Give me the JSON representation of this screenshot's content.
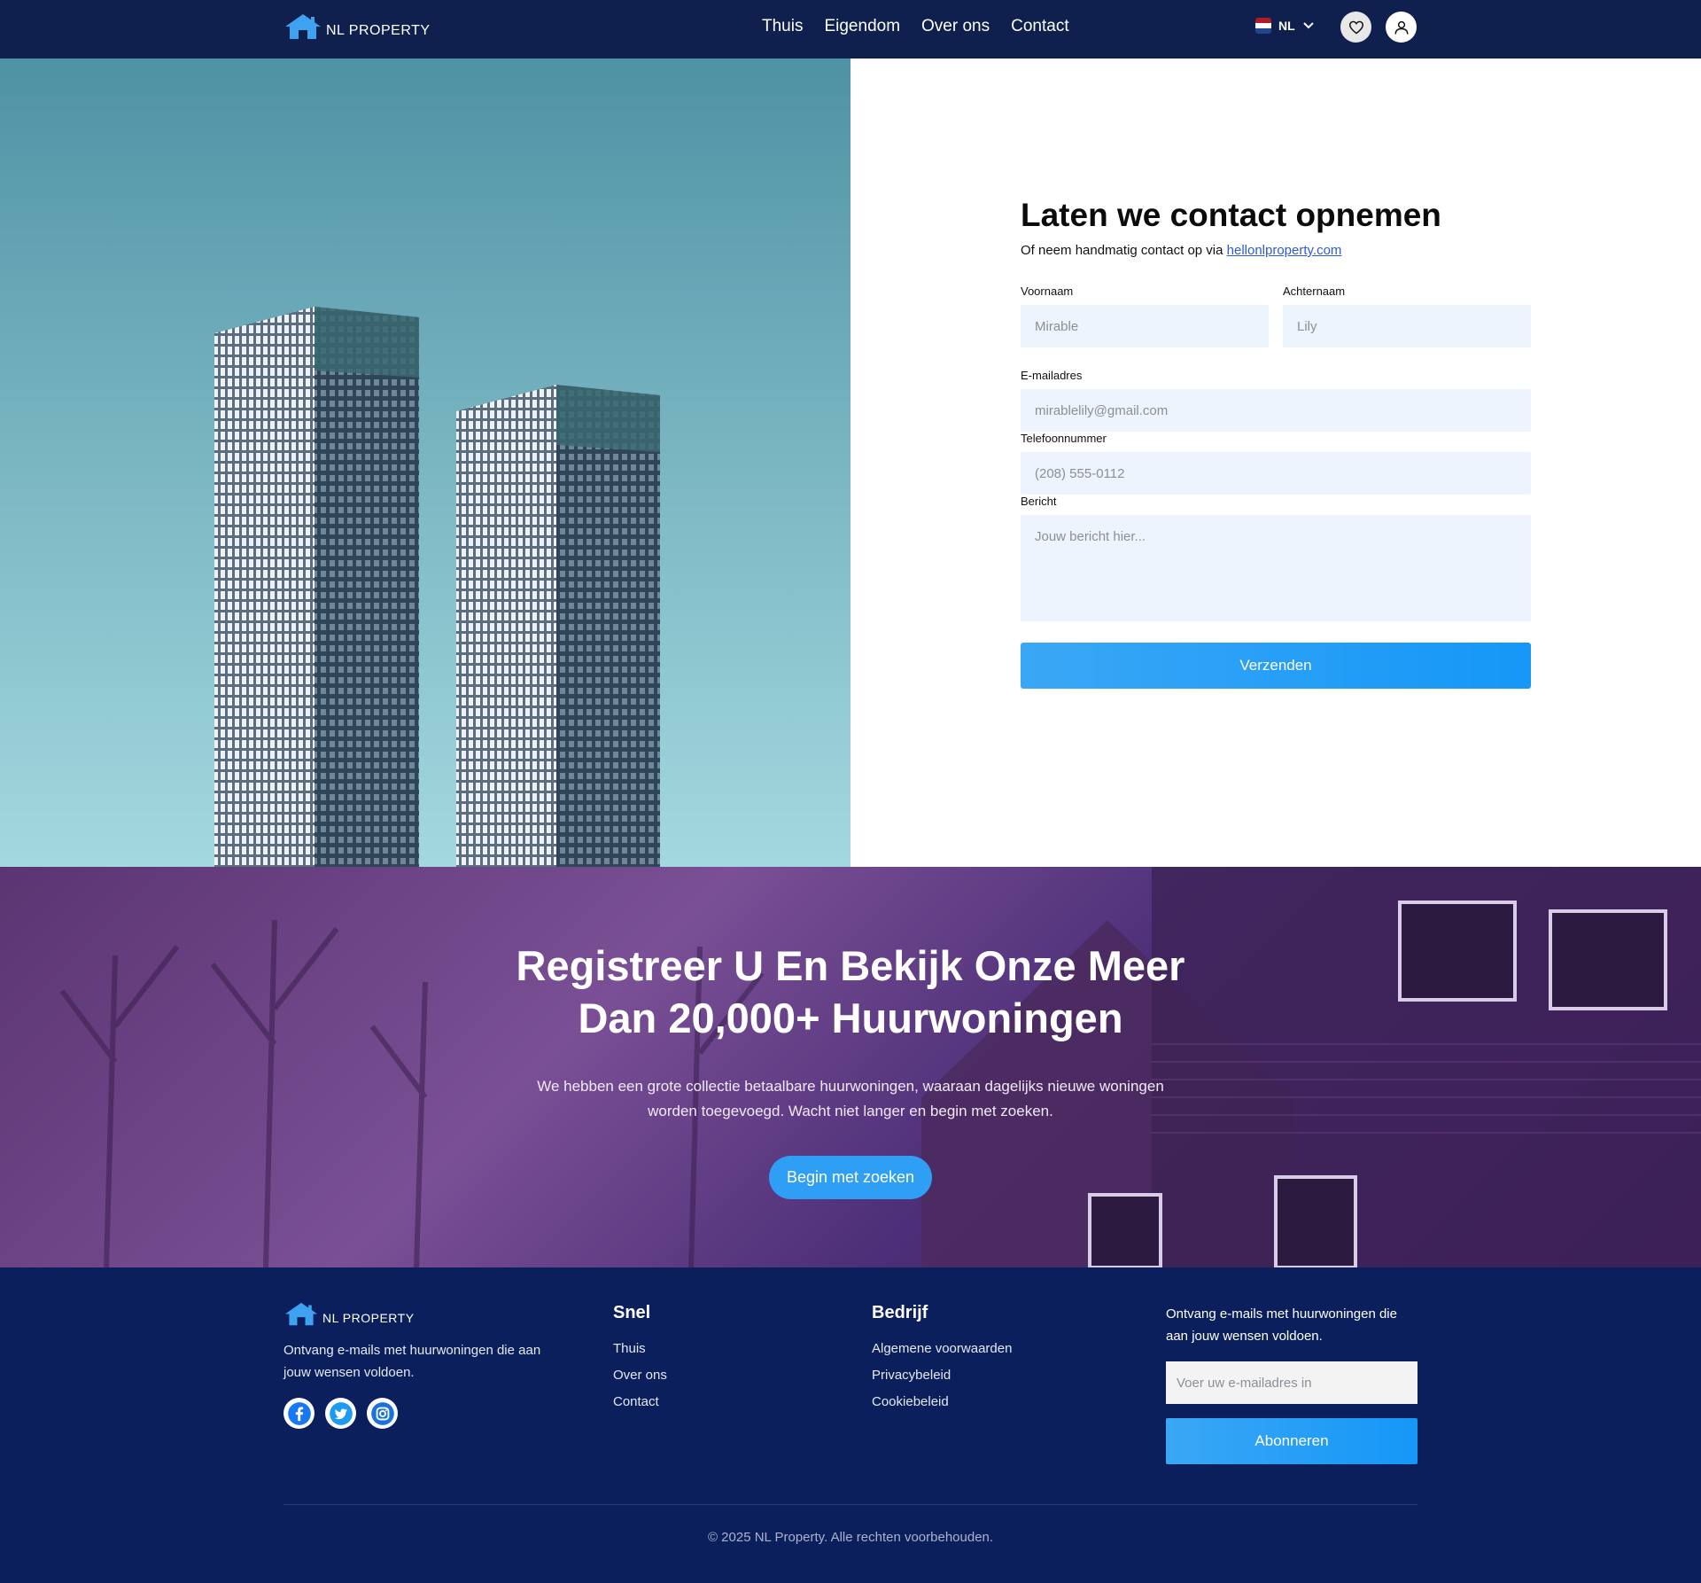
{
  "header": {
    "brand": "NL PROPERTY",
    "nav": [
      "Thuis",
      "Eigendom",
      "Over ons",
      "Contact"
    ],
    "language": "NL"
  },
  "contact": {
    "title": "Laten we contact opnemen",
    "subtitle_prefix": "Of neem handmatig contact op via ",
    "email_link": "hellonlproperty.com",
    "first_name": {
      "label": "Voornaam",
      "placeholder": "Mirable"
    },
    "last_name": {
      "label": "Achternaam",
      "placeholder": "Lily"
    },
    "email": {
      "label": "E-mailadres",
      "placeholder": "mirablelily@gmail.com"
    },
    "phone": {
      "label": "Telefoonnummer",
      "placeholder": "(208) 555-0112"
    },
    "message": {
      "label": "Bericht",
      "placeholder": "Jouw bericht hier..."
    },
    "submit": "Verzenden"
  },
  "cta": {
    "title_line1": "Registreer U En Bekijk Onze Meer",
    "title_line2": "Dan 20,000+ Huurwoningen",
    "text_line1": "We hebben een grote collectie betaalbare huurwoningen, waaraan dagelijks nieuwe woningen",
    "text_line2": "worden toegevoegd. Wacht niet langer en begin met zoeken.",
    "button": "Begin met zoeken"
  },
  "footer": {
    "brand": "NL PROPERTY",
    "description": "Ontvang e-mails met huurwoningen die aan jouw wensen voldoen.",
    "quick": {
      "title": "Snel",
      "links": [
        "Thuis",
        "Over ons",
        "Contact"
      ]
    },
    "company": {
      "title": "Bedrijf",
      "links": [
        "Algemene voorwaarden",
        "Privacybeleid",
        "Cookiebeleid"
      ]
    },
    "newsletter": {
      "text": "Ontvang e-mails met huurwoningen die aan jouw wensen voldoen.",
      "placeholder": "Voer uw e-mailadres in",
      "button": "Abonneren"
    },
    "copyright": "© 2025 NL Property. Alle rechten voorbehouden."
  },
  "colors": {
    "header_bg": "#10204e",
    "footer_bg": "#0b1f5c",
    "accent": "#2f9ff5",
    "input_bg": "#eef4fd",
    "cta_overlay": "#5b3572"
  },
  "icons": [
    "house-logo-icon",
    "nl-flag-icon",
    "chevron-down-icon",
    "heart-icon",
    "user-icon",
    "facebook-icon",
    "twitter-icon",
    "instagram-icon"
  ]
}
